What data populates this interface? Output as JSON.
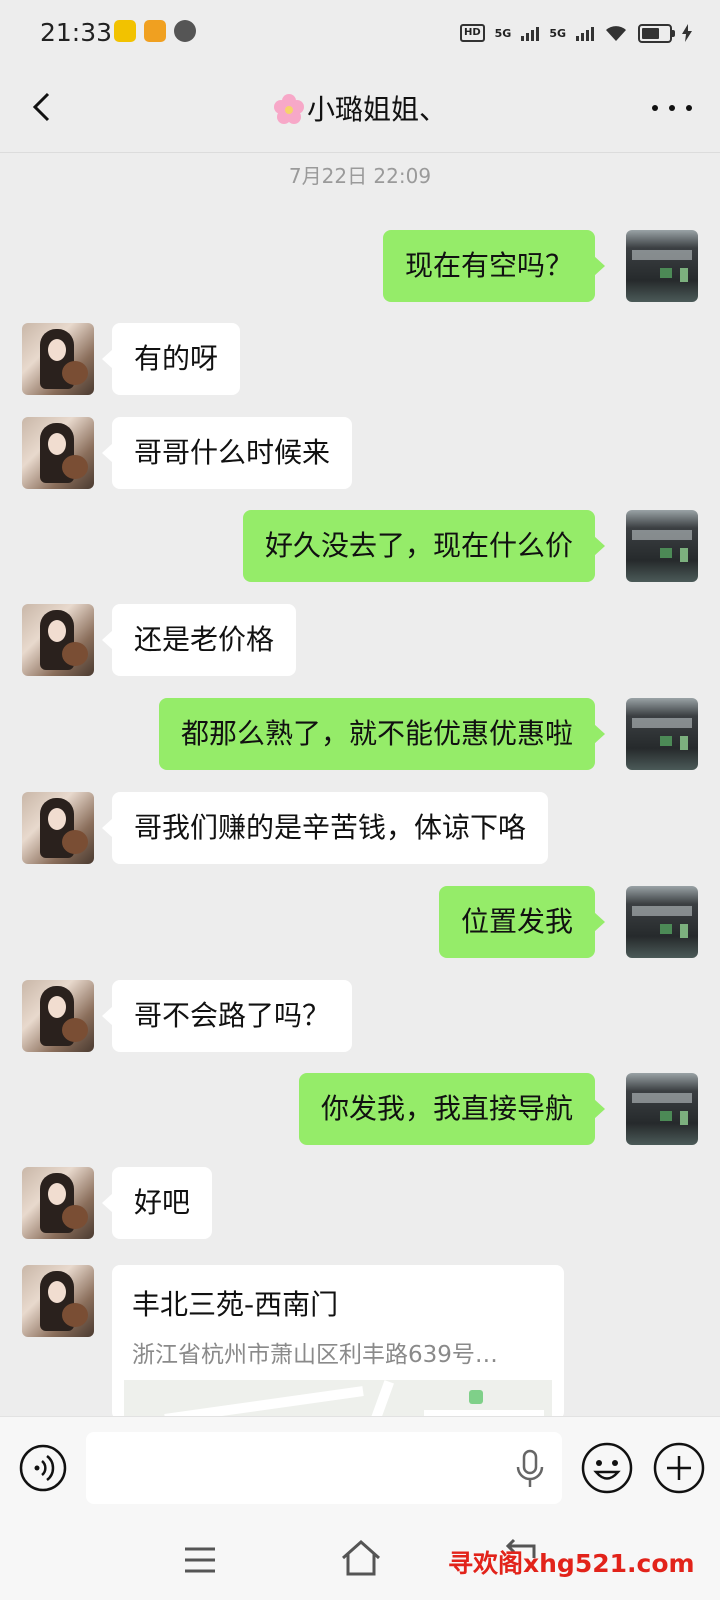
{
  "status_bar": {
    "time": "21:33",
    "network_a": "5G",
    "network_b": "5G",
    "hd_label": "HD",
    "battery_fraction": 0.7
  },
  "header": {
    "title": "小璐姐姐、"
  },
  "chat": {
    "timestamp": "7月22日 22:09",
    "messages": [
      {
        "side": "out",
        "text": "现在有空吗？"
      },
      {
        "side": "in",
        "text": "有的呀"
      },
      {
        "side": "in",
        "text": "哥哥什么时候来"
      },
      {
        "side": "out",
        "text": "好久没去了，现在什么价"
      },
      {
        "side": "in",
        "text": "还是老价格"
      },
      {
        "side": "out",
        "text": "都那么熟了，就不能优惠优惠啦"
      },
      {
        "side": "in",
        "text": "哥我们赚的是辛苦钱，体谅下咯"
      },
      {
        "side": "out",
        "text": "位置发我"
      },
      {
        "side": "in",
        "text": "哥不会路了吗？"
      },
      {
        "side": "out",
        "text": "你发我，我直接导航"
      },
      {
        "side": "in",
        "text": "好吧"
      }
    ],
    "location": {
      "name": "丰北三苑-西南门",
      "address": "浙江省杭州市萧山区利丰路639号…"
    }
  },
  "input_bar": {
    "value": "",
    "placeholder": ""
  },
  "watermark": {
    "text": "寻欢阁xhg521.com"
  }
}
